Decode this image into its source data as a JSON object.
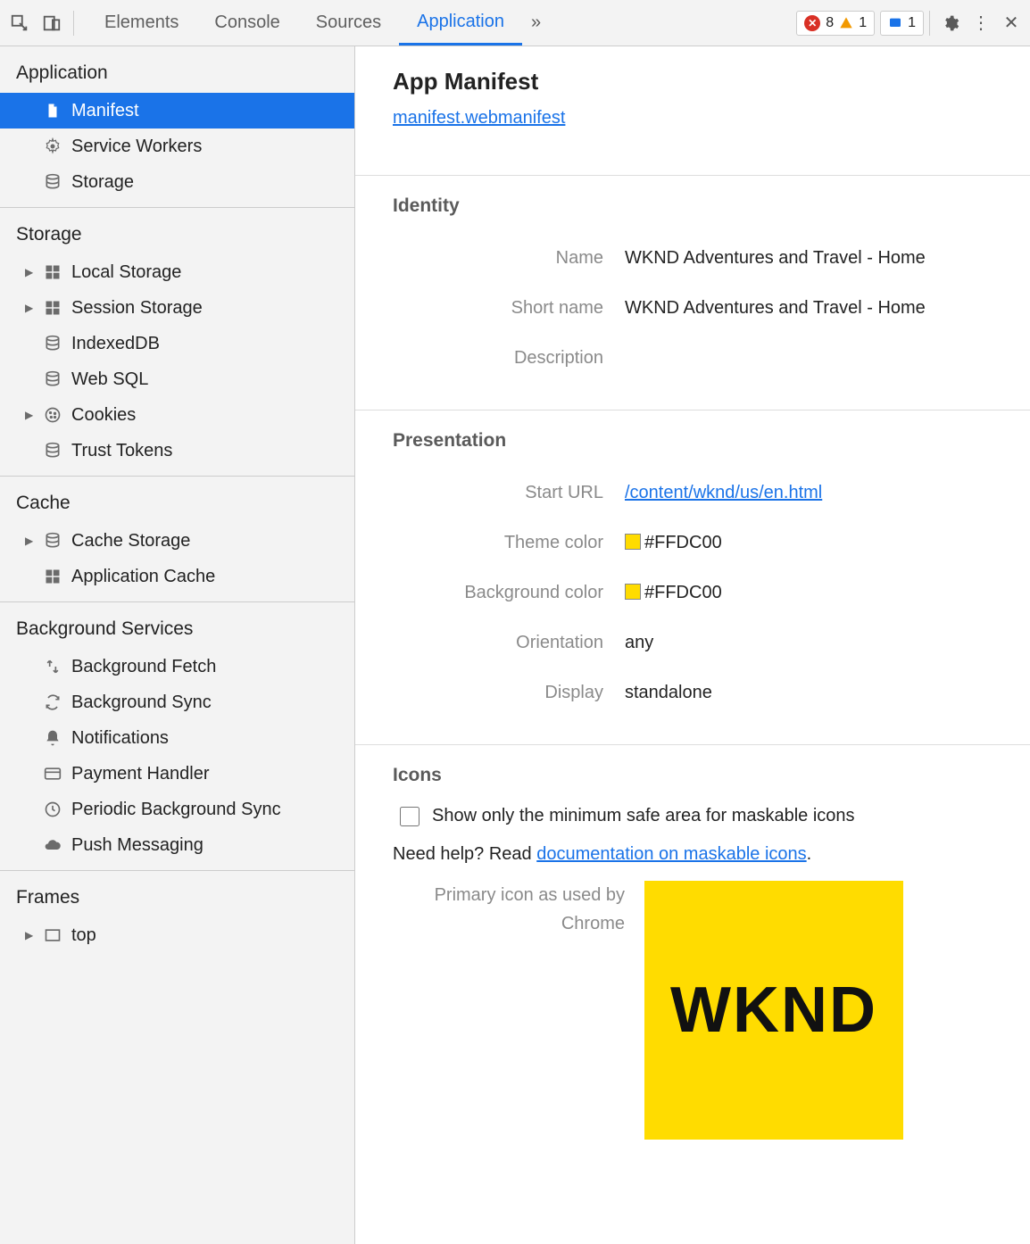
{
  "toolbar": {
    "tabs": [
      "Elements",
      "Console",
      "Sources",
      "Application"
    ],
    "active_tab": "Application",
    "errors": "8",
    "warnings": "1",
    "info": "1"
  },
  "sidebar": {
    "sections": [
      {
        "title": "Application",
        "items": [
          {
            "label": "Manifest",
            "icon": "file",
            "selected": true,
            "expandable": false
          },
          {
            "label": "Service Workers",
            "icon": "gear",
            "selected": false,
            "expandable": false
          },
          {
            "label": "Storage",
            "icon": "db",
            "selected": false,
            "expandable": false
          }
        ]
      },
      {
        "title": "Storage",
        "items": [
          {
            "label": "Local Storage",
            "icon": "grid",
            "expandable": true
          },
          {
            "label": "Session Storage",
            "icon": "grid",
            "expandable": true
          },
          {
            "label": "IndexedDB",
            "icon": "db",
            "expandable": false
          },
          {
            "label": "Web SQL",
            "icon": "db",
            "expandable": false
          },
          {
            "label": "Cookies",
            "icon": "cookie",
            "expandable": true
          },
          {
            "label": "Trust Tokens",
            "icon": "db",
            "expandable": false
          }
        ]
      },
      {
        "title": "Cache",
        "items": [
          {
            "label": "Cache Storage",
            "icon": "db",
            "expandable": true
          },
          {
            "label": "Application Cache",
            "icon": "grid",
            "expandable": false
          }
        ]
      },
      {
        "title": "Background Services",
        "items": [
          {
            "label": "Background Fetch",
            "icon": "fetch",
            "expandable": false
          },
          {
            "label": "Background Sync",
            "icon": "sync",
            "expandable": false
          },
          {
            "label": "Notifications",
            "icon": "bell",
            "expandable": false
          },
          {
            "label": "Payment Handler",
            "icon": "card",
            "expandable": false
          },
          {
            "label": "Periodic Background Sync",
            "icon": "clock",
            "expandable": false
          },
          {
            "label": "Push Messaging",
            "icon": "cloud",
            "expandable": false
          }
        ]
      },
      {
        "title": "Frames",
        "items": [
          {
            "label": "top",
            "icon": "frame",
            "expandable": true
          }
        ]
      }
    ]
  },
  "content": {
    "title": "App Manifest",
    "manifest_link": "manifest.webmanifest",
    "identity": {
      "heading": "Identity",
      "rows": [
        {
          "k": "Name",
          "v": "WKND Adventures and Travel - Home"
        },
        {
          "k": "Short name",
          "v": "WKND Adventures and Travel - Home"
        },
        {
          "k": "Description",
          "v": ""
        }
      ]
    },
    "presentation": {
      "heading": "Presentation",
      "start_url_k": "Start URL",
      "start_url_v": "/content/wknd/us/en.html",
      "theme_color_k": "Theme color",
      "theme_color_v": "#FFDC00",
      "bg_color_k": "Background color",
      "bg_color_v": "#FFDC00",
      "orientation_k": "Orientation",
      "orientation_v": "any",
      "display_k": "Display",
      "display_v": "standalone"
    },
    "icons": {
      "heading": "Icons",
      "checkbox_label": "Show only the minimum safe area for maskable icons",
      "help_prefix": "Need help? Read ",
      "help_link": "documentation on maskable icons",
      "help_suffix": ".",
      "primary_label": "Primary icon as used by Chrome",
      "icon_text": "WKND",
      "icon_bg": "#FFDC00"
    }
  }
}
